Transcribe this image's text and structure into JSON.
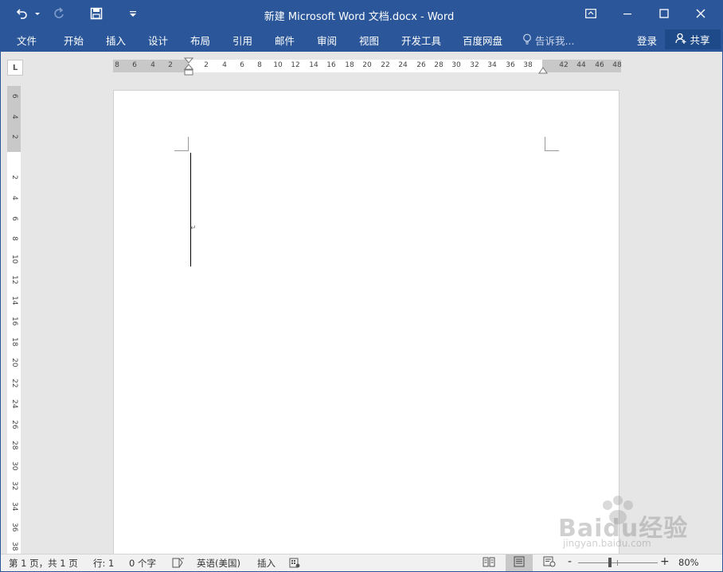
{
  "title_bar": {
    "title": "新建 Microsoft Word 文档.docx - Word"
  },
  "quick_access": {
    "undo_icon": "undo-icon",
    "redo_icon": "redo-icon",
    "save_icon": "save-icon",
    "customize_icon": "customize-qat-icon"
  },
  "window_controls": {
    "ribbon_display_icon": "ribbon-display-options-icon",
    "minimize_icon": "minimize-icon",
    "maximize_icon": "maximize-icon",
    "close_icon": "close-icon"
  },
  "ribbon": {
    "tabs": [
      {
        "label": "文件"
      },
      {
        "label": "开始"
      },
      {
        "label": "插入"
      },
      {
        "label": "设计"
      },
      {
        "label": "布局"
      },
      {
        "label": "引用"
      },
      {
        "label": "邮件"
      },
      {
        "label": "审阅"
      },
      {
        "label": "视图"
      },
      {
        "label": "开发工具"
      },
      {
        "label": "百度网盘"
      }
    ],
    "tell_me": "告诉我...",
    "login": "登录",
    "share": "共享"
  },
  "ruler": {
    "tab_selector": "L",
    "horizontal_left": [
      "8",
      "6",
      "4",
      "2"
    ],
    "horizontal_main": [
      "2",
      "4",
      "6",
      "8",
      "10",
      "12",
      "14",
      "16",
      "18",
      "20",
      "22",
      "24",
      "26",
      "28",
      "30",
      "32",
      "34",
      "36",
      "38"
    ],
    "horizontal_right": [
      "42",
      "44",
      "46",
      "48"
    ],
    "vertical_top": [
      "6",
      "4",
      "2"
    ],
    "vertical_main": [
      "2",
      "4",
      "6",
      "8",
      "10",
      "12",
      "14",
      "16",
      "18",
      "20",
      "22",
      "24",
      "26",
      "28",
      "30",
      "32",
      "34",
      "36",
      "38"
    ]
  },
  "status_bar": {
    "page": "第 1 页，共 1 页",
    "line": "行: 1",
    "words": "0 个字",
    "language": "英语(美国)",
    "insert_mode": "插入",
    "zoom_minus": "-",
    "zoom_plus": "+",
    "zoom_level": "80%",
    "zoom_fraction": 0.4
  },
  "watermark": {
    "brand": "Baidu经验",
    "url": "jingyan.baidu.com"
  },
  "colors": {
    "title_blue": "#2b579a",
    "share_button": "#1e4a89",
    "workspace": "#e6e6e6"
  }
}
